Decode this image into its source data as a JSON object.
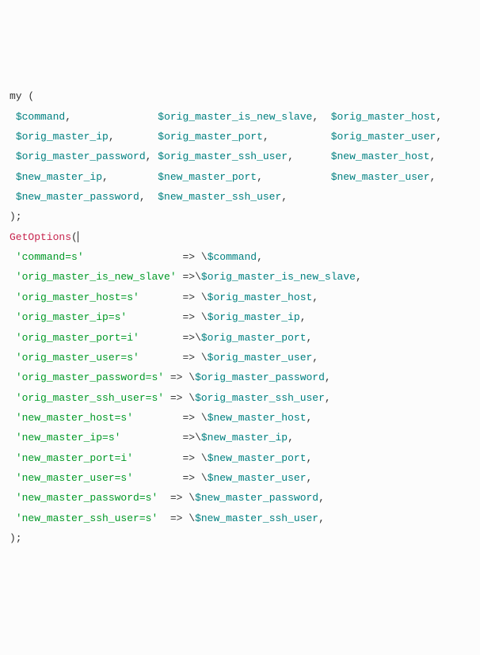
{
  "code": {
    "my_kw": "my",
    "decl_vars": [
      [
        "$command,",
        "$orig_master_is_new_slave,",
        "$orig_master_host,"
      ],
      [
        "$orig_master_ip,",
        "$orig_master_port,",
        "$orig_master_user,"
      ],
      [
        "$orig_master_password,",
        "$orig_master_ssh_user,",
        "$new_master_host,"
      ],
      [
        "$new_master_ip,",
        "$new_master_port,",
        "$new_master_user,"
      ],
      [
        "$new_master_password,",
        "$new_master_ssh_user,",
        ""
      ]
    ],
    "fn": "GetOptions",
    "opts": [
      {
        "key": "'command=s'",
        "arrow": "=>",
        "sp": " ",
        "val": "\\$command,",
        "pad": 27
      },
      {
        "key": "'orig_master_is_new_slave'",
        "arrow": "=>",
        "sp": "",
        "val": "\\$orig_master_is_new_slave,",
        "pad": 27
      },
      {
        "key": "'orig_master_host=s'",
        "arrow": "=>",
        "sp": " ",
        "val": "\\$orig_master_host,",
        "pad": 27
      },
      {
        "key": "'orig_master_ip=s'",
        "arrow": "=>",
        "sp": " ",
        "val": "\\$orig_master_ip,",
        "pad": 27
      },
      {
        "key": "'orig_master_port=i'",
        "arrow": "=>",
        "sp": "",
        "val": "\\$orig_master_port,",
        "pad": 27
      },
      {
        "key": "'orig_master_user=s'",
        "arrow": "=>",
        "sp": " ",
        "val": "\\$orig_master_user,",
        "pad": 27
      },
      {
        "key": "'orig_master_password=s'",
        "arrow": "=>",
        "sp": " ",
        "val": "\\$orig_master_password,",
        "pad": 25
      },
      {
        "key": "'orig_master_ssh_user=s'",
        "arrow": "=>",
        "sp": " ",
        "val": "\\$orig_master_ssh_user,",
        "pad": 25
      },
      {
        "key": "'new_master_host=s'",
        "arrow": "=>",
        "sp": " ",
        "val": "\\$new_master_host,",
        "pad": 27
      },
      {
        "key": "'new_master_ip=s'",
        "arrow": "=>",
        "sp": "",
        "val": "\\$new_master_ip,",
        "pad": 27
      },
      {
        "key": "'new_master_port=i'",
        "arrow": "=>",
        "sp": " ",
        "val": "\\$new_master_port,",
        "pad": 27
      },
      {
        "key": "'new_master_user=s'",
        "arrow": "=>",
        "sp": " ",
        "val": "\\$new_master_user,",
        "pad": 27
      },
      {
        "key": "'new_master_password=s'",
        "arrow": "=>",
        "sp": " ",
        "val": "\\$new_master_password,",
        "pad": 25
      },
      {
        "key": "'new_master_ssh_user=s'",
        "arrow": "=>",
        "sp": " ",
        "val": "\\$new_master_ssh_user,",
        "pad": 25
      }
    ]
  }
}
